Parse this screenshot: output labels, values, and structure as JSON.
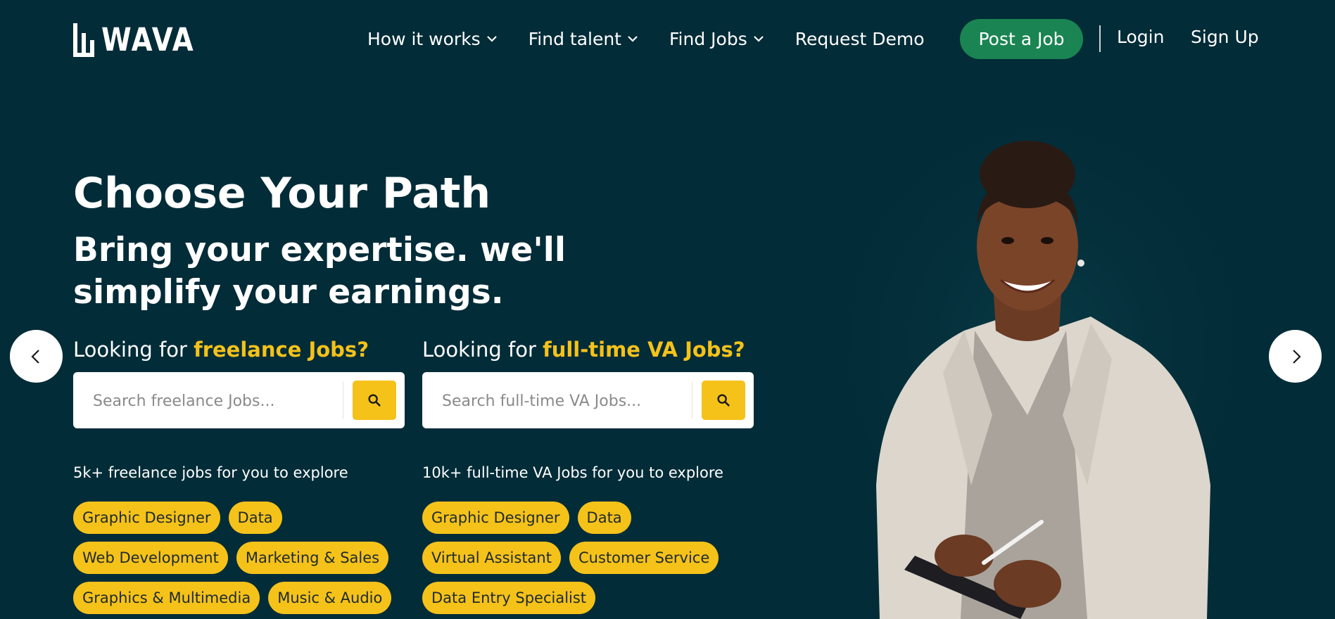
{
  "brand": {
    "name": "WAVA"
  },
  "nav": {
    "items": [
      {
        "label": "How it works",
        "dropdown": true
      },
      {
        "label": "Find talent",
        "dropdown": true
      },
      {
        "label": "Find Jobs",
        "dropdown": true
      },
      {
        "label": "Request Demo",
        "dropdown": false
      }
    ],
    "post_job": "Post a Job",
    "login": "Login",
    "signup": "Sign Up"
  },
  "hero": {
    "title": "Choose Your Path",
    "subtitle": "Bring your expertise. we'll simplify your earnings."
  },
  "freelance": {
    "prefix": "Looking for ",
    "highlight": "freelance Jobs?",
    "placeholder": "Search freelance Jobs...",
    "count_text": "5k+ freelance jobs for you to explore",
    "tags": [
      "Graphic Designer",
      "Data",
      "Web Development",
      "Marketing & Sales",
      "Graphics & Multimedia",
      "Music & Audio"
    ]
  },
  "fulltime": {
    "prefix": "Looking for ",
    "highlight": "full-time VA Jobs?",
    "placeholder": "Search full-time VA Jobs...",
    "count_text": "10k+ full-time VA Jobs for you to explore",
    "tags": [
      "Graphic Designer",
      "Data",
      "Virtual Assistant",
      "Customer Service",
      "Data Entry Specialist"
    ]
  },
  "carousel": {
    "prev_icon": "chevron-left-icon",
    "next_icon": "chevron-right-icon"
  },
  "colors": {
    "background": "#022c38",
    "accent_yellow": "#f5c21a",
    "post_button": "#1a8552",
    "text": "#ffffff"
  }
}
